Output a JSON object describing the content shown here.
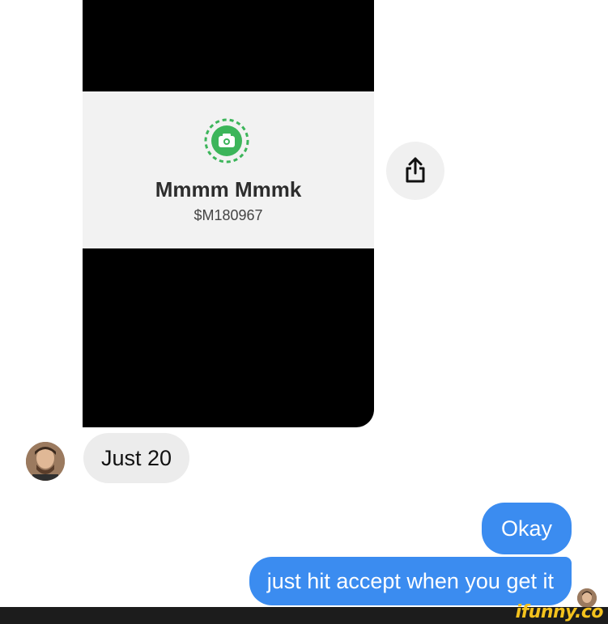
{
  "payment_card": {
    "name": "Mmmm Mmmk",
    "cashtag": "$M180967",
    "icon": "camera-icon",
    "accent_color": "#3cb55a"
  },
  "share_button": {
    "icon": "share-icon"
  },
  "messages": [
    {
      "sender": "other",
      "text": "Just 20"
    },
    {
      "sender": "me",
      "text": "Okay"
    },
    {
      "sender": "me",
      "text": "just hit accept when you get it"
    }
  ],
  "colors": {
    "outgoing_bubble": "#3b8cf0",
    "incoming_bubble": "#ececec",
    "watermark": "#f4c21d"
  },
  "watermark": {
    "text": "ifunny.co"
  }
}
